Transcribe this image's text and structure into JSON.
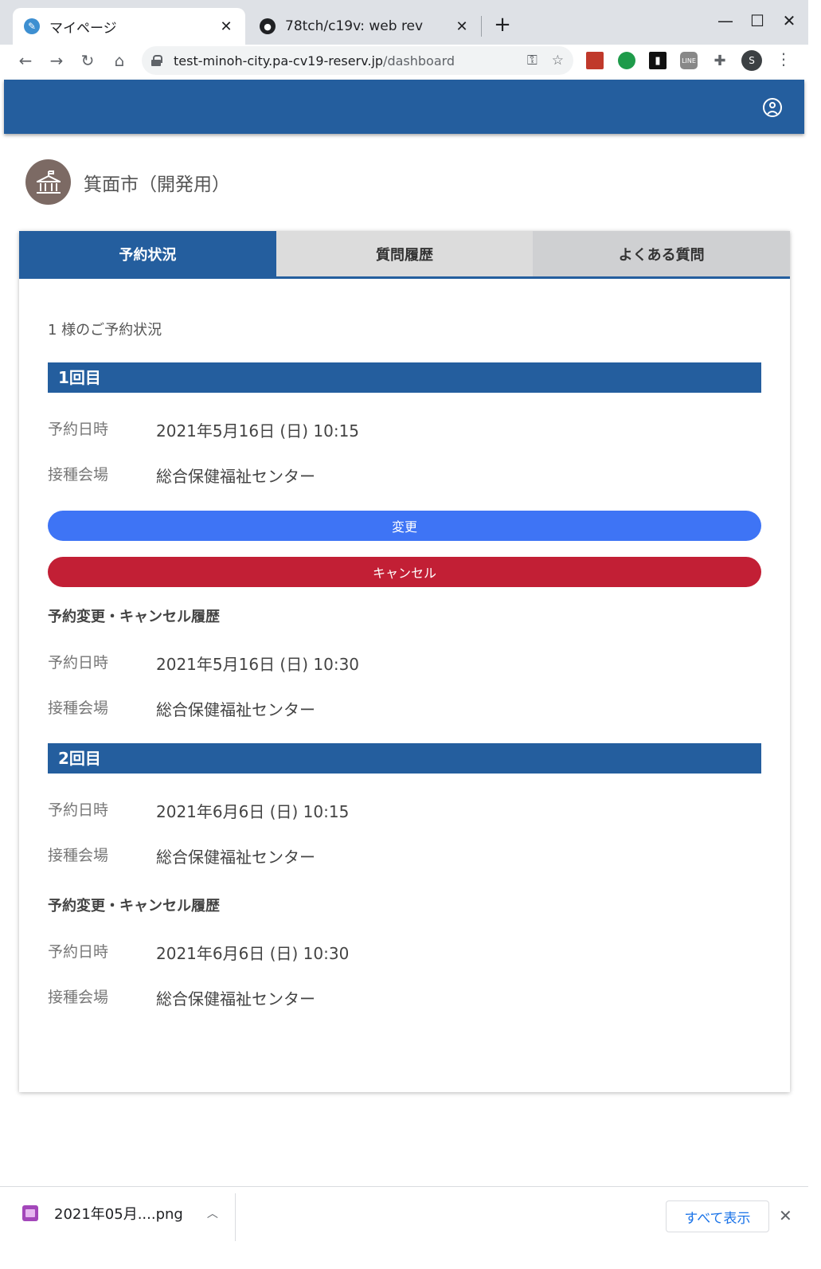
{
  "browser": {
    "tabs": [
      {
        "title": "マイページ",
        "favicon": "pen-icon"
      },
      {
        "title": "78tch/c19v: web rev",
        "favicon": "github-icon"
      }
    ],
    "url_host": "test-minoh-city.pa-cv19-reserv.jp",
    "url_path": "/dashboard",
    "profile_initial": "S",
    "icons": {
      "new_tab": "+",
      "close": "✕",
      "minimize": "—",
      "maximize": "☐"
    }
  },
  "org": {
    "name": "箕面市（開発用）",
    "icon": "city-hall-icon"
  },
  "page_tabs": [
    {
      "label": "予約状況",
      "active": true
    },
    {
      "label": "質問履歴",
      "active": false
    },
    {
      "label": "よくある質問",
      "active": false
    }
  ],
  "greeting": "1 様のご予約状況",
  "labels": {
    "date": "予約日時",
    "venue": "接種会場",
    "history": "予約変更・キャンセル履歴"
  },
  "doses": [
    {
      "title": "1回目",
      "date": "2021年5月16日 (日) 10:15",
      "venue": "総合保健福祉センター",
      "buttons": {
        "change": "変更",
        "cancel": "キャンセル"
      },
      "history": {
        "date": "2021年5月16日 (日) 10:30",
        "venue": "総合保健福祉センター"
      }
    },
    {
      "title": "2回目",
      "date": "2021年6月6日 (日) 10:15",
      "venue": "総合保健福祉センター",
      "history": {
        "date": "2021年6月6日 (日) 10:30",
        "venue": "総合保健福祉センター"
      }
    }
  ],
  "download": {
    "filename": "2021年05月....png",
    "show_all": "すべて表示"
  },
  "colors": {
    "primary": "#245e9e",
    "change": "#3e74f5",
    "cancel": "#c21f35"
  }
}
